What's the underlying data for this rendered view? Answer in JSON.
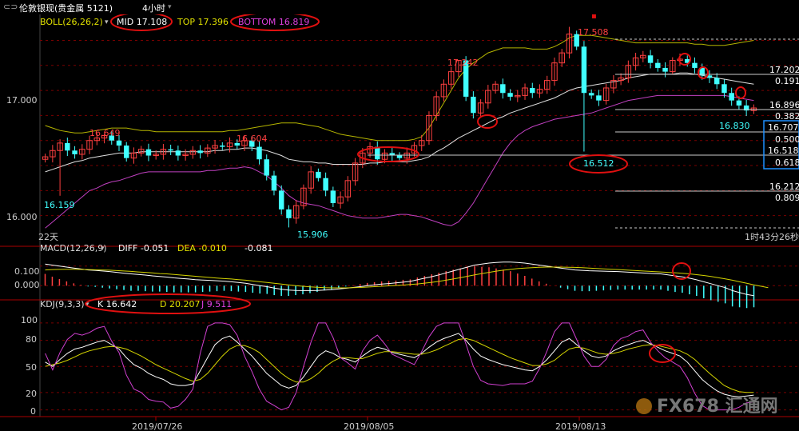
{
  "window": {
    "title": "伦敦银现(贵金属 5121)",
    "timeframe": "4小时"
  },
  "colors": {
    "up": "#ff4040",
    "down": "#40ffff",
    "mid": "#e0e0e0",
    "top": "#b4b400",
    "bottom": "#c040c0",
    "k": "#ffffff",
    "d": "#d4d400",
    "j": "#d040d0",
    "grid": "#7a0000",
    "annot": "#e01010"
  },
  "boll_panel": {
    "header": "BOLL(26,26,2)",
    "mid_label": "MID 17.108",
    "top_label": "TOP 17.396",
    "bottom_label": "BOTTOM 16.819",
    "price_ticks": [
      "17.000",
      "16.000"
    ],
    "period_label": "22天",
    "countdown": "1时43分26秒",
    "highs": [
      "16.649",
      "16.604",
      "17.242",
      "17.508"
    ],
    "lows": [
      "16.159",
      "15.906",
      "16.512",
      "16.830"
    ],
    "fib_levels": [
      "17.202",
      "0.191",
      "16.896",
      "0.382",
      "16.707",
      "0.500",
      "16.518",
      "0.618",
      "16.212",
      "0.809"
    ]
  },
  "macd_panel": {
    "header": "MACD(12,26,9)",
    "diff": "DIFF -0.051",
    "dea": "DEA -0.010",
    "macd": "-0.081",
    "ticks": [
      "0.100",
      "0.000"
    ]
  },
  "kdj_panel": {
    "header": "KDJ(9,3,3)",
    "k": "K 16.642",
    "d": "D 20.207",
    "j": "J 9.511",
    "ticks": [
      "100",
      "80",
      "50",
      "20",
      "0"
    ]
  },
  "x_axis": {
    "dates": [
      "2019/07/26",
      "2019/08/05",
      "2019/08/13"
    ]
  },
  "watermark": "FX678 汇通网",
  "chart_data": [
    {
      "type": "candlestick",
      "title": "BOLL(26,26,2)",
      "ylim": [
        15.8,
        17.55
      ],
      "closes": [
        16.47,
        16.52,
        16.58,
        16.52,
        16.49,
        16.53,
        16.6,
        16.62,
        16.64,
        16.6,
        16.56,
        16.46,
        16.5,
        16.53,
        16.48,
        16.49,
        16.53,
        16.52,
        16.48,
        16.49,
        16.52,
        16.5,
        16.54,
        16.56,
        16.55,
        16.58,
        16.56,
        16.6,
        16.55,
        16.45,
        16.32,
        16.2,
        16.05,
        15.98,
        16.08,
        16.22,
        16.35,
        16.3,
        16.2,
        16.1,
        16.15,
        16.28,
        16.42,
        16.5,
        16.55,
        16.45,
        16.5,
        16.48,
        16.46,
        16.5,
        16.56,
        16.6,
        16.8,
        16.95,
        17.05,
        17.15,
        17.24,
        16.95,
        16.82,
        16.9,
        17.0,
        17.05,
        16.98,
        16.95,
        16.96,
        17.02,
        16.98,
        17.01,
        17.08,
        17.22,
        17.3,
        17.45,
        17.35,
        16.98,
        16.96,
        16.92,
        17.02,
        17.08,
        17.1,
        17.2,
        17.26,
        17.28,
        17.22,
        17.18,
        17.15,
        17.24,
        17.25,
        17.22,
        17.18,
        17.12,
        17.1,
        17.05,
        16.98,
        16.92,
        16.88,
        16.84,
        16.86
      ],
      "series": [
        {
          "name": "MID",
          "values": [
            16.35,
            16.37,
            16.39,
            16.41,
            16.43,
            16.44,
            16.46,
            16.47,
            16.48,
            16.49,
            16.5,
            16.5,
            16.5,
            16.51,
            16.51,
            16.51,
            16.51,
            16.51,
            16.51,
            16.51,
            16.51,
            16.51,
            16.51,
            16.52,
            16.52,
            16.53,
            16.53,
            16.54,
            16.54,
            16.53,
            16.52,
            16.5,
            16.48,
            16.45,
            16.44,
            16.43,
            16.43,
            16.42,
            16.42,
            16.41,
            16.41,
            16.41,
            16.41,
            16.41,
            16.42,
            16.42,
            16.43,
            16.43,
            16.43,
            16.43,
            16.44,
            16.45,
            16.47,
            16.51,
            16.54,
            16.58,
            16.62,
            16.65,
            16.68,
            16.71,
            16.74,
            16.77,
            16.79,
            16.82,
            16.84,
            16.86,
            16.88,
            16.9,
            16.92,
            16.94,
            16.97,
            17.0,
            17.02,
            17.03,
            17.04,
            17.05,
            17.06,
            17.07,
            17.08,
            17.1,
            17.11,
            17.12,
            17.13,
            17.13,
            17.13,
            17.13,
            17.14,
            17.14,
            17.13,
            17.12,
            17.11,
            17.1,
            17.09,
            17.08,
            17.07,
            17.06,
            17.05
          ]
        },
        {
          "name": "TOP",
          "values": [
            16.72,
            16.7,
            16.68,
            16.67,
            16.66,
            16.66,
            16.67,
            16.68,
            16.69,
            16.7,
            16.7,
            16.7,
            16.69,
            16.68,
            16.68,
            16.67,
            16.67,
            16.67,
            16.67,
            16.67,
            16.67,
            16.67,
            16.67,
            16.67,
            16.67,
            16.68,
            16.68,
            16.69,
            16.7,
            16.71,
            16.72,
            16.73,
            16.74,
            16.74,
            16.74,
            16.73,
            16.72,
            16.71,
            16.69,
            16.67,
            16.65,
            16.64,
            16.63,
            16.62,
            16.61,
            16.6,
            16.6,
            16.6,
            16.6,
            16.6,
            16.61,
            16.63,
            16.7,
            16.8,
            16.9,
            17.0,
            17.1,
            17.17,
            17.22,
            17.26,
            17.3,
            17.32,
            17.34,
            17.34,
            17.34,
            17.34,
            17.33,
            17.33,
            17.33,
            17.35,
            17.38,
            17.42,
            17.44,
            17.44,
            17.44,
            17.43,
            17.42,
            17.41,
            17.4,
            17.39,
            17.38,
            17.38,
            17.38,
            17.38,
            17.38,
            17.38,
            17.38,
            17.38,
            17.37,
            17.37,
            17.36,
            17.36,
            17.36,
            17.37,
            17.38,
            17.39,
            17.4
          ]
        },
        {
          "name": "BOTTOM",
          "values": [
            15.9,
            15.95,
            16.0,
            16.05,
            16.1,
            16.15,
            16.2,
            16.22,
            16.25,
            16.27,
            16.28,
            16.3,
            16.32,
            16.34,
            16.35,
            16.35,
            16.35,
            16.35,
            16.35,
            16.35,
            16.35,
            16.35,
            16.36,
            16.36,
            16.37,
            16.38,
            16.38,
            16.39,
            16.38,
            16.35,
            16.32,
            16.27,
            16.22,
            16.16,
            16.12,
            16.1,
            16.09,
            16.08,
            16.06,
            16.04,
            16.02,
            16.0,
            15.99,
            15.98,
            15.98,
            15.98,
            15.99,
            16.0,
            16.01,
            16.01,
            16.0,
            15.99,
            15.97,
            15.95,
            15.93,
            15.92,
            15.95,
            16.02,
            16.1,
            16.2,
            16.3,
            16.4,
            16.5,
            16.58,
            16.64,
            16.68,
            16.71,
            16.73,
            16.75,
            16.77,
            16.78,
            16.79,
            16.8,
            16.81,
            16.82,
            16.84,
            16.86,
            16.88,
            16.9,
            16.92,
            16.93,
            16.94,
            16.95,
            16.96,
            16.96,
            16.96,
            16.96,
            16.96,
            16.96,
            16.96,
            16.96,
            16.96,
            16.96,
            16.95,
            16.94,
            16.93,
            16.92
          ]
        }
      ],
      "annotations": [
        {
          "label": "16.649",
          "kind": "high"
        },
        {
          "label": "16.604",
          "kind": "high"
        },
        {
          "label": "17.242",
          "kind": "high"
        },
        {
          "label": "17.508",
          "kind": "high"
        },
        {
          "label": "16.159",
          "kind": "low"
        },
        {
          "label": "15.906",
          "kind": "low"
        },
        {
          "label": "16.512",
          "kind": "low"
        },
        {
          "label": "16.830",
          "kind": "low"
        }
      ]
    },
    {
      "type": "line",
      "title": "MACD(12,26,9)",
      "ylim": [
        -0.06,
        0.16
      ],
      "series": [
        {
          "name": "DIFF",
          "values": [
            0.11,
            0.105,
            0.1,
            0.095,
            0.09,
            0.085,
            0.08,
            0.078,
            0.075,
            0.072,
            0.068,
            0.064,
            0.06,
            0.057,
            0.054,
            0.05,
            0.047,
            0.044,
            0.04,
            0.037,
            0.034,
            0.031,
            0.029,
            0.027,
            0.025,
            0.023,
            0.02,
            0.016,
            0.012,
            0.006,
            0.0,
            -0.005,
            -0.012,
            -0.018,
            -0.022,
            -0.024,
            -0.025,
            -0.025,
            -0.024,
            -0.022,
            -0.02,
            -0.017,
            -0.013,
            -0.009,
            -0.005,
            0.0,
            0.004,
            0.008,
            0.011,
            0.014,
            0.018,
            0.022,
            0.03,
            0.038,
            0.046,
            0.055,
            0.065,
            0.075,
            0.085,
            0.095,
            0.105,
            0.11,
            0.115,
            0.118,
            0.12,
            0.12,
            0.118,
            0.115,
            0.11,
            0.105,
            0.1,
            0.095,
            0.09,
            0.085,
            0.08,
            0.078,
            0.076,
            0.075,
            0.074,
            0.073,
            0.072,
            0.07,
            0.068,
            0.066,
            0.064,
            0.062,
            0.06,
            0.055,
            0.05,
            0.045,
            0.038,
            0.03,
            0.02,
            0.01,
            0.0,
            -0.01,
            -0.025,
            -0.035,
            -0.045,
            -0.051
          ]
        },
        {
          "name": "DEA",
          "values": [
            0.08,
            0.082,
            0.083,
            0.084,
            0.084,
            0.083,
            0.082,
            0.081,
            0.08,
            0.079,
            0.077,
            0.075,
            0.073,
            0.07,
            0.068,
            0.065,
            0.062,
            0.06,
            0.057,
            0.054,
            0.051,
            0.048,
            0.045,
            0.042,
            0.039,
            0.036,
            0.034,
            0.031,
            0.028,
            0.024,
            0.02,
            0.016,
            0.012,
            0.008,
            0.004,
            0.0,
            -0.003,
            -0.006,
            -0.008,
            -0.01,
            -0.011,
            -0.011,
            -0.011,
            -0.01,
            -0.009,
            -0.007,
            -0.005,
            -0.003,
            -0.001,
            0.001,
            0.003,
            0.006,
            0.009,
            0.013,
            0.017,
            0.022,
            0.028,
            0.034,
            0.041,
            0.048,
            0.055,
            0.062,
            0.068,
            0.074,
            0.079,
            0.083,
            0.087,
            0.09,
            0.092,
            0.094,
            0.095,
            0.095,
            0.095,
            0.094,
            0.093,
            0.092,
            0.09,
            0.088,
            0.086,
            0.084,
            0.082,
            0.08,
            0.078,
            0.076,
            0.074,
            0.072,
            0.07,
            0.068,
            0.066,
            0.063,
            0.06,
            0.056,
            0.052,
            0.047,
            0.041,
            0.035,
            0.028,
            0.02,
            0.012,
            0.004,
            -0.003,
            -0.01
          ]
        }
      ]
    },
    {
      "type": "line",
      "title": "KDJ(9,3,3)",
      "ylim": [
        -5,
        110
      ],
      "series": [
        {
          "name": "K",
          "values": [
            55,
            50,
            58,
            65,
            70,
            72,
            75,
            78,
            80,
            75,
            70,
            60,
            52,
            48,
            42,
            38,
            35,
            30,
            28,
            28,
            30,
            45,
            60,
            75,
            82,
            85,
            78,
            70,
            62,
            52,
            42,
            35,
            28,
            25,
            28,
            38,
            50,
            62,
            68,
            65,
            60,
            58,
            55,
            62,
            68,
            72,
            70,
            66,
            64,
            62,
            60,
            65,
            72,
            78,
            82,
            85,
            88,
            80,
            70,
            62,
            58,
            55,
            52,
            50,
            48,
            46,
            45,
            50,
            58,
            68,
            78,
            82,
            75,
            68,
            62,
            60,
            62,
            68,
            72,
            75,
            78,
            80,
            76,
            72,
            68,
            65,
            62,
            55,
            45,
            35,
            28,
            22,
            18,
            16,
            15,
            16,
            17
          ]
        },
        {
          "name": "D",
          "values": [
            50,
            52,
            54,
            57,
            61,
            65,
            68,
            70,
            72,
            73,
            72,
            70,
            66,
            62,
            57,
            52,
            48,
            44,
            40,
            36,
            33,
            35,
            42,
            52,
            62,
            70,
            74,
            74,
            71,
            66,
            58,
            50,
            42,
            36,
            32,
            32,
            36,
            42,
            50,
            56,
            60,
            60,
            59,
            59,
            62,
            65,
            67,
            67,
            66,
            65,
            64,
            64,
            66,
            69,
            73,
            77,
            81,
            82,
            80,
            76,
            72,
            68,
            64,
            60,
            57,
            54,
            51,
            51,
            53,
            57,
            64,
            70,
            72,
            71,
            68,
            65,
            64,
            65,
            67,
            70,
            72,
            74,
            75,
            74,
            72,
            70,
            68,
            64,
            58,
            50,
            42,
            35,
            28,
            24,
            21,
            20,
            20
          ]
        },
        {
          "name": "J",
          "values": [
            65,
            46,
            66,
            81,
            88,
            86,
            89,
            94,
            96,
            79,
            66,
            40,
            24,
            20,
            12,
            10,
            9,
            2,
            4,
            12,
            24,
            65,
            96,
            100,
            100,
            98,
            86,
            62,
            44,
            24,
            10,
            5,
            0,
            3,
            20,
            50,
            78,
            100,
            100,
            83,
            60,
            54,
            47,
            68,
            80,
            86,
            76,
            64,
            60,
            56,
            52,
            67,
            84,
            96,
            100,
            100,
            100,
            76,
            50,
            34,
            30,
            29,
            28,
            30,
            30,
            30,
            33,
            48,
            68,
            90,
            100,
            100,
            81,
            62,
            50,
            50,
            58,
            74,
            82,
            85,
            90,
            92,
            78,
            68,
            60,
            55,
            50,
            37,
            19,
            5,
            0,
            0,
            0,
            0,
            3,
            8,
            9
          ]
        }
      ]
    }
  ]
}
